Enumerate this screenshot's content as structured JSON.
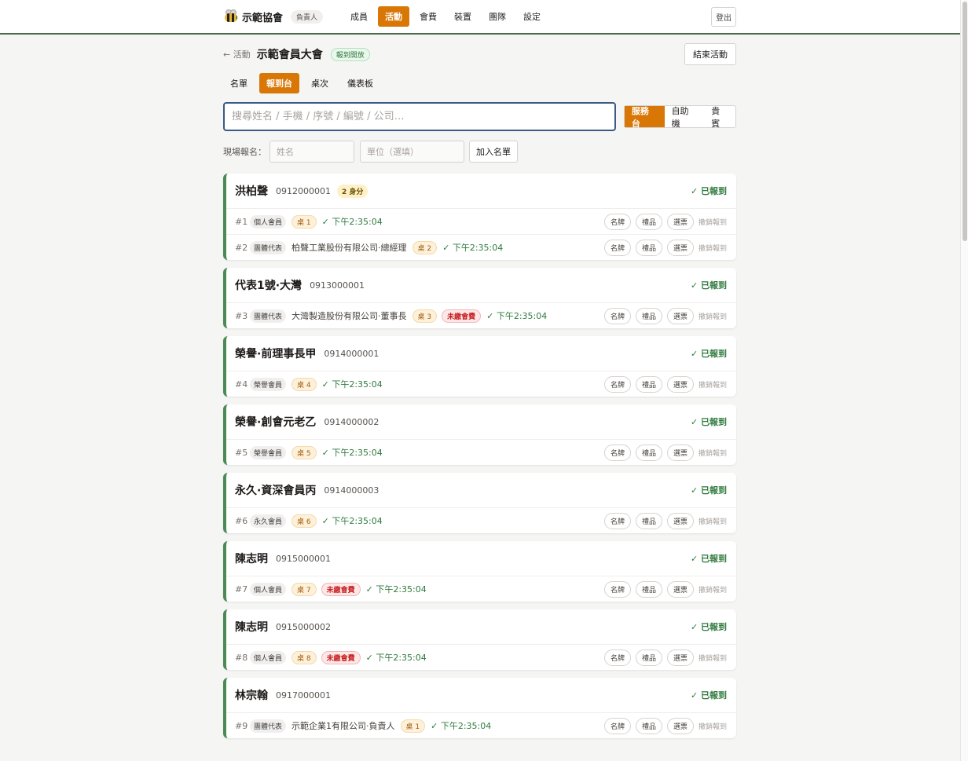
{
  "nav": {
    "org_name": "示範協會",
    "role": "負責人",
    "items": [
      "成員",
      "活動",
      "會費",
      "裝置",
      "團隊",
      "設定"
    ],
    "active": "活動",
    "logout": "登出"
  },
  "header": {
    "back": "← 活動",
    "title": "示範會員大會",
    "status": "報到開放",
    "end_button": "結束活動"
  },
  "subtabs": {
    "items": [
      "名單",
      "報到台",
      "桌次",
      "儀表板"
    ],
    "active": "報到台"
  },
  "search": {
    "placeholder": "搜尋姓名 / 手機 / 序號 / 編號 / 公司…",
    "value": ""
  },
  "modes": {
    "items": [
      "服務台",
      "自助機",
      "貴賓"
    ],
    "active": "服務台"
  },
  "walkin": {
    "label": "現場報名：",
    "name_placeholder": "姓名",
    "unit_placeholder": "單位（選填）",
    "add_button": "加入名單"
  },
  "labels": {
    "checked_in": "✓ 已報到",
    "badge_btn": "名牌",
    "gift_btn": "禮品",
    "ballot_btn": "選票",
    "undo": "撤銷報到"
  },
  "attendees": [
    {
      "name": "洪柏聲",
      "phone": "0912000001",
      "multi": "2 身分",
      "entries": [
        {
          "seq": "#1",
          "type": "個人會員",
          "company": "",
          "table": "桌 1",
          "unpaid": "",
          "time": "✓ 下午2:35:04"
        },
        {
          "seq": "#2",
          "type": "團體代表",
          "company": "柏聲工業股份有限公司·總經理",
          "table": "桌 2",
          "unpaid": "",
          "time": "✓ 下午2:35:04"
        }
      ]
    },
    {
      "name": "代表1號·大灣",
      "phone": "0913000001",
      "multi": "",
      "entries": [
        {
          "seq": "#3",
          "type": "團體代表",
          "company": "大灣製造股份有限公司·董事長",
          "table": "桌 3",
          "unpaid": "未繳會費",
          "time": "✓ 下午2:35:04"
        }
      ]
    },
    {
      "name": "榮譽·前理事長甲",
      "phone": "0914000001",
      "multi": "",
      "entries": [
        {
          "seq": "#4",
          "type": "榮譽會員",
          "company": "",
          "table": "桌 4",
          "unpaid": "",
          "time": "✓ 下午2:35:04"
        }
      ]
    },
    {
      "name": "榮譽·創會元老乙",
      "phone": "0914000002",
      "multi": "",
      "entries": [
        {
          "seq": "#5",
          "type": "榮譽會員",
          "company": "",
          "table": "桌 5",
          "unpaid": "",
          "time": "✓ 下午2:35:04"
        }
      ]
    },
    {
      "name": "永久·資深會員丙",
      "phone": "0914000003",
      "multi": "",
      "entries": [
        {
          "seq": "#6",
          "type": "永久會員",
          "company": "",
          "table": "桌 6",
          "unpaid": "",
          "time": "✓ 下午2:35:04"
        }
      ]
    },
    {
      "name": "陳志明",
      "phone": "0915000001",
      "multi": "",
      "entries": [
        {
          "seq": "#7",
          "type": "個人會員",
          "company": "",
          "table": "桌 7",
          "unpaid": "未繳會費",
          "time": "✓ 下午2:35:04"
        }
      ]
    },
    {
      "name": "陳志明",
      "phone": "0915000002",
      "multi": "",
      "entries": [
        {
          "seq": "#8",
          "type": "個人會員",
          "company": "",
          "table": "桌 8",
          "unpaid": "未繳會費",
          "time": "✓ 下午2:35:04"
        }
      ]
    },
    {
      "name": "林宗翰",
      "phone": "0917000001",
      "multi": "",
      "entries": [
        {
          "seq": "#9",
          "type": "團體代表",
          "company": "示範企業1有限公司·負責人",
          "table": "桌 1",
          "unpaid": "",
          "time": "✓ 下午2:35:04"
        }
      ]
    }
  ]
}
